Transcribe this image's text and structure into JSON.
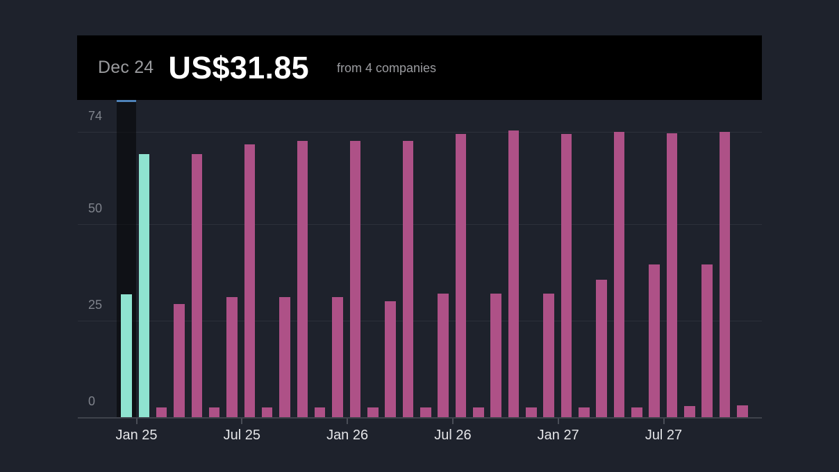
{
  "tooltip": {
    "date": "Dec 24",
    "value": "US$31.85",
    "source": "from 4 companies"
  },
  "colors": {
    "background": "#1e222c",
    "tooltip_background": "#000000",
    "bar_actual": "#8fe3d0",
    "bar_estimate": "#ae5187",
    "hover_band": "rgba(0,0,0,0.5)",
    "hover_indicator": "#4e82b8",
    "gridline": "#2d313b",
    "axis_line": "#3f434c",
    "y_label": "#7f838c",
    "x_label": "#e4e5e8"
  },
  "chart_data": {
    "type": "bar",
    "title": "",
    "xlabel": "",
    "ylabel": "",
    "unit": "US$",
    "grid": true,
    "legend": false,
    "ylim": [
      0,
      82
    ],
    "y_ticks": [
      74,
      50,
      25,
      0
    ],
    "x_ticks": [
      "Jan 25",
      "Jul 25",
      "Jan 26",
      "Jul 26",
      "Jan 27",
      "Jul 27"
    ],
    "hovered_point": {
      "label": "Dec 24",
      "value": 31.85,
      "companies": 4
    },
    "points": [
      {
        "label": "Dec 24",
        "value": 31.85,
        "state": "actual"
      },
      {
        "label": "Jan 25",
        "value": 68.2,
        "state": "actual"
      },
      {
        "label": "Feb 25",
        "value": 2.5,
        "state": "estimate"
      },
      {
        "label": "Mar 25",
        "value": 29.3,
        "state": "estimate"
      },
      {
        "label": "Apr 25",
        "value": 68.2,
        "state": "estimate"
      },
      {
        "label": "May 25",
        "value": 2.5,
        "state": "estimate"
      },
      {
        "label": "Jun 25",
        "value": 31.1,
        "state": "estimate"
      },
      {
        "label": "Jul 25",
        "value": 70.8,
        "state": "estimate"
      },
      {
        "label": "Aug 25",
        "value": 2.5,
        "state": "estimate"
      },
      {
        "label": "Sep 25",
        "value": 31.1,
        "state": "estimate"
      },
      {
        "label": "Oct 25",
        "value": 71.6,
        "state": "estimate"
      },
      {
        "label": "Nov 25",
        "value": 2.5,
        "state": "estimate"
      },
      {
        "label": "Dec 25",
        "value": 31.1,
        "state": "estimate"
      },
      {
        "label": "Jan 26",
        "value": 71.6,
        "state": "estimate"
      },
      {
        "label": "Feb 26",
        "value": 2.5,
        "state": "estimate"
      },
      {
        "label": "Mar 26",
        "value": 30.1,
        "state": "estimate"
      },
      {
        "label": "Apr 26",
        "value": 71.6,
        "state": "estimate"
      },
      {
        "label": "May 26",
        "value": 2.5,
        "state": "estimate"
      },
      {
        "label": "Jun 26",
        "value": 32.1,
        "state": "estimate"
      },
      {
        "label": "Jul 26",
        "value": 73.5,
        "state": "estimate"
      },
      {
        "label": "Aug 26",
        "value": 2.5,
        "state": "estimate"
      },
      {
        "label": "Sep 26",
        "value": 32.0,
        "state": "estimate"
      },
      {
        "label": "Oct 26",
        "value": 74.3,
        "state": "estimate"
      },
      {
        "label": "Nov 26",
        "value": 2.5,
        "state": "estimate"
      },
      {
        "label": "Dec 26",
        "value": 32.1,
        "state": "estimate"
      },
      {
        "label": "Jan 27",
        "value": 73.5,
        "state": "estimate"
      },
      {
        "label": "Feb 27",
        "value": 2.5,
        "state": "estimate"
      },
      {
        "label": "Mar 27",
        "value": 35.6,
        "state": "estimate"
      },
      {
        "label": "Apr 27",
        "value": 74.0,
        "state": "estimate"
      },
      {
        "label": "May 27",
        "value": 2.6,
        "state": "estimate"
      },
      {
        "label": "Jun 27",
        "value": 39.7,
        "state": "estimate"
      },
      {
        "label": "Jul 27",
        "value": 73.7,
        "state": "estimate"
      },
      {
        "label": "Aug 27",
        "value": 2.8,
        "state": "estimate"
      },
      {
        "label": "Sep 27",
        "value": 39.6,
        "state": "estimate"
      },
      {
        "label": "Oct 27",
        "value": 74.0,
        "state": "estimate"
      },
      {
        "label": "Nov 27",
        "value": 3.1,
        "state": "estimate"
      }
    ]
  }
}
